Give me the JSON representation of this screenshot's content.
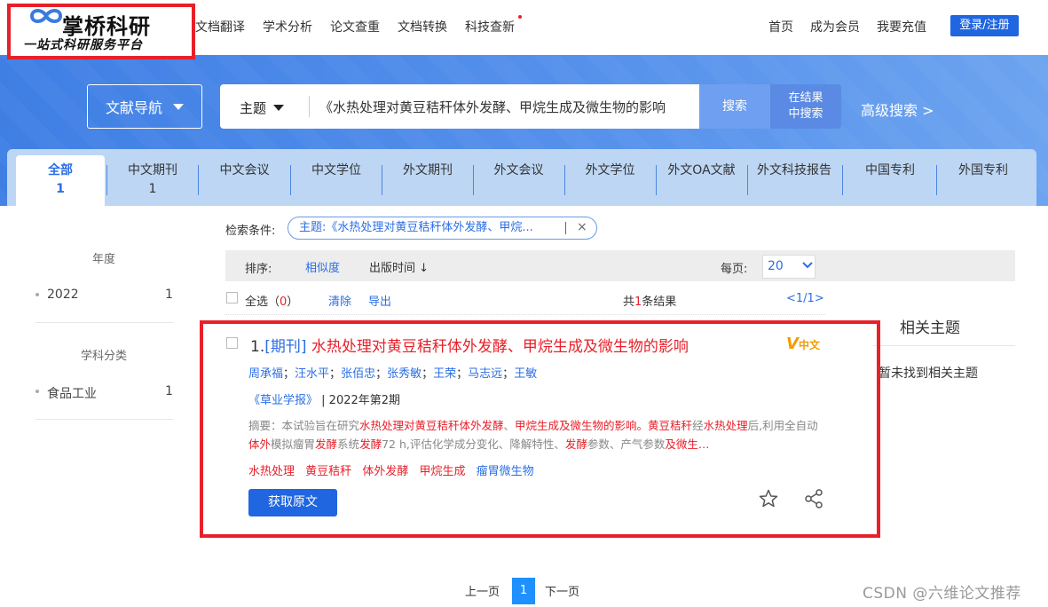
{
  "brand": {
    "name": "掌桥科研",
    "tagline": "一站式科研服务平台"
  },
  "top_nav": [
    "文档翻译",
    "学术分析",
    "论文查重",
    "文档转换",
    "科技查新"
  ],
  "right_nav": {
    "home": "首页",
    "member": "成为会员",
    "recharge": "我要充值",
    "login": "登录/注册"
  },
  "search": {
    "nav_label": "文献导航",
    "type": "主题",
    "query": "《水热处理对黄豆秸秆体外发酵、甲烷生成及微生物的影响",
    "search_btn": "搜索",
    "in_result_line1": "在结果",
    "in_result_line2": "中搜索",
    "advanced": "高级搜索 >"
  },
  "tabs": [
    {
      "label": "全部",
      "count": "1"
    },
    {
      "label": "中文期刊",
      "count": "1"
    },
    {
      "label": "中文会议",
      "count": ""
    },
    {
      "label": "中文学位",
      "count": ""
    },
    {
      "label": "外文期刊",
      "count": ""
    },
    {
      "label": "外文会议",
      "count": ""
    },
    {
      "label": "外文学位",
      "count": ""
    },
    {
      "label": "外文OA文献",
      "count": ""
    },
    {
      "label": "外文科技报告",
      "count": ""
    },
    {
      "label": "中国专利",
      "count": ""
    },
    {
      "label": "外国专利",
      "count": ""
    }
  ],
  "sidebar": {
    "year_title": "年度",
    "year_items": [
      {
        "label": "2022",
        "count": "1"
      }
    ],
    "subject_title": "学科分类",
    "subject_items": [
      {
        "label": "食品工业",
        "count": "1"
      }
    ]
  },
  "conditions": {
    "label": "检索条件:",
    "chip": "主题:《水热处理对黄豆秸秆体外发酵、甲烷..."
  },
  "sort": {
    "label": "排序:",
    "relevance": "相似度",
    "date": "出版时间 ↓",
    "per_page_label": "每页:",
    "per_page": "20"
  },
  "list_ops": {
    "select_all": "全选（",
    "selected": "0",
    "select_all_end": "）",
    "clear": "清除",
    "export": "导出",
    "total_pre": "共",
    "total_num": "1",
    "total_post": "条结果",
    "pager": "<1/1>"
  },
  "result": {
    "index": "1.",
    "kind": "[期刊]",
    "title": "水热处理对黄豆秸秆体外发酵、甲烷生成及微生物的影响",
    "lang_badge": "中文",
    "authors": [
      "周承福",
      "汪水平",
      "张佰忠",
      "张秀敏",
      "王荣",
      "马志远",
      "王敏"
    ],
    "journal": "《草业学报》",
    "issue": "| 2022年第2期",
    "abstract_parts": [
      {
        "t": "摘要：本试验旨在研究",
        "hl": false
      },
      {
        "t": "水热处理对黄豆秸秆体外发酵",
        "hl": true
      },
      {
        "t": "、",
        "hl": false
      },
      {
        "t": "甲烷生成及微生物的影响。黄豆秸秆",
        "hl": true
      },
      {
        "t": "经",
        "hl": false
      },
      {
        "t": "水热处理",
        "hl": true
      },
      {
        "t": "后,利用全自动",
        "hl": false
      },
      {
        "t": "体外",
        "hl": true
      },
      {
        "t": "模拟瘤胃",
        "hl": false
      },
      {
        "t": "发酵",
        "hl": true
      },
      {
        "t": "系统",
        "hl": false
      },
      {
        "t": "发酵",
        "hl": true
      },
      {
        "t": "72 h,评估化学成分变化、降解特性、",
        "hl": false
      },
      {
        "t": "发酵",
        "hl": true
      },
      {
        "t": "参数、产气参数",
        "hl": false
      },
      {
        "t": "及微生…",
        "hl": true
      }
    ],
    "keywords": [
      "水热处理",
      "黄豆秸秆",
      "体外发酵",
      "甲烷生成",
      "瘤胃微生物"
    ],
    "get_btn": "获取原文"
  },
  "related": {
    "title": "相关主题",
    "empty": "暂未找到相关主题"
  },
  "pagination": {
    "prev": "上一页",
    "current": "1",
    "next": "下一页"
  },
  "watermark": "CSDN @六维论文推荐",
  "colors": {
    "accent": "#1f66e0",
    "highlight": "#e8202a",
    "tabs_bg": "#bdd6f4",
    "hero": "#4a88e8"
  }
}
